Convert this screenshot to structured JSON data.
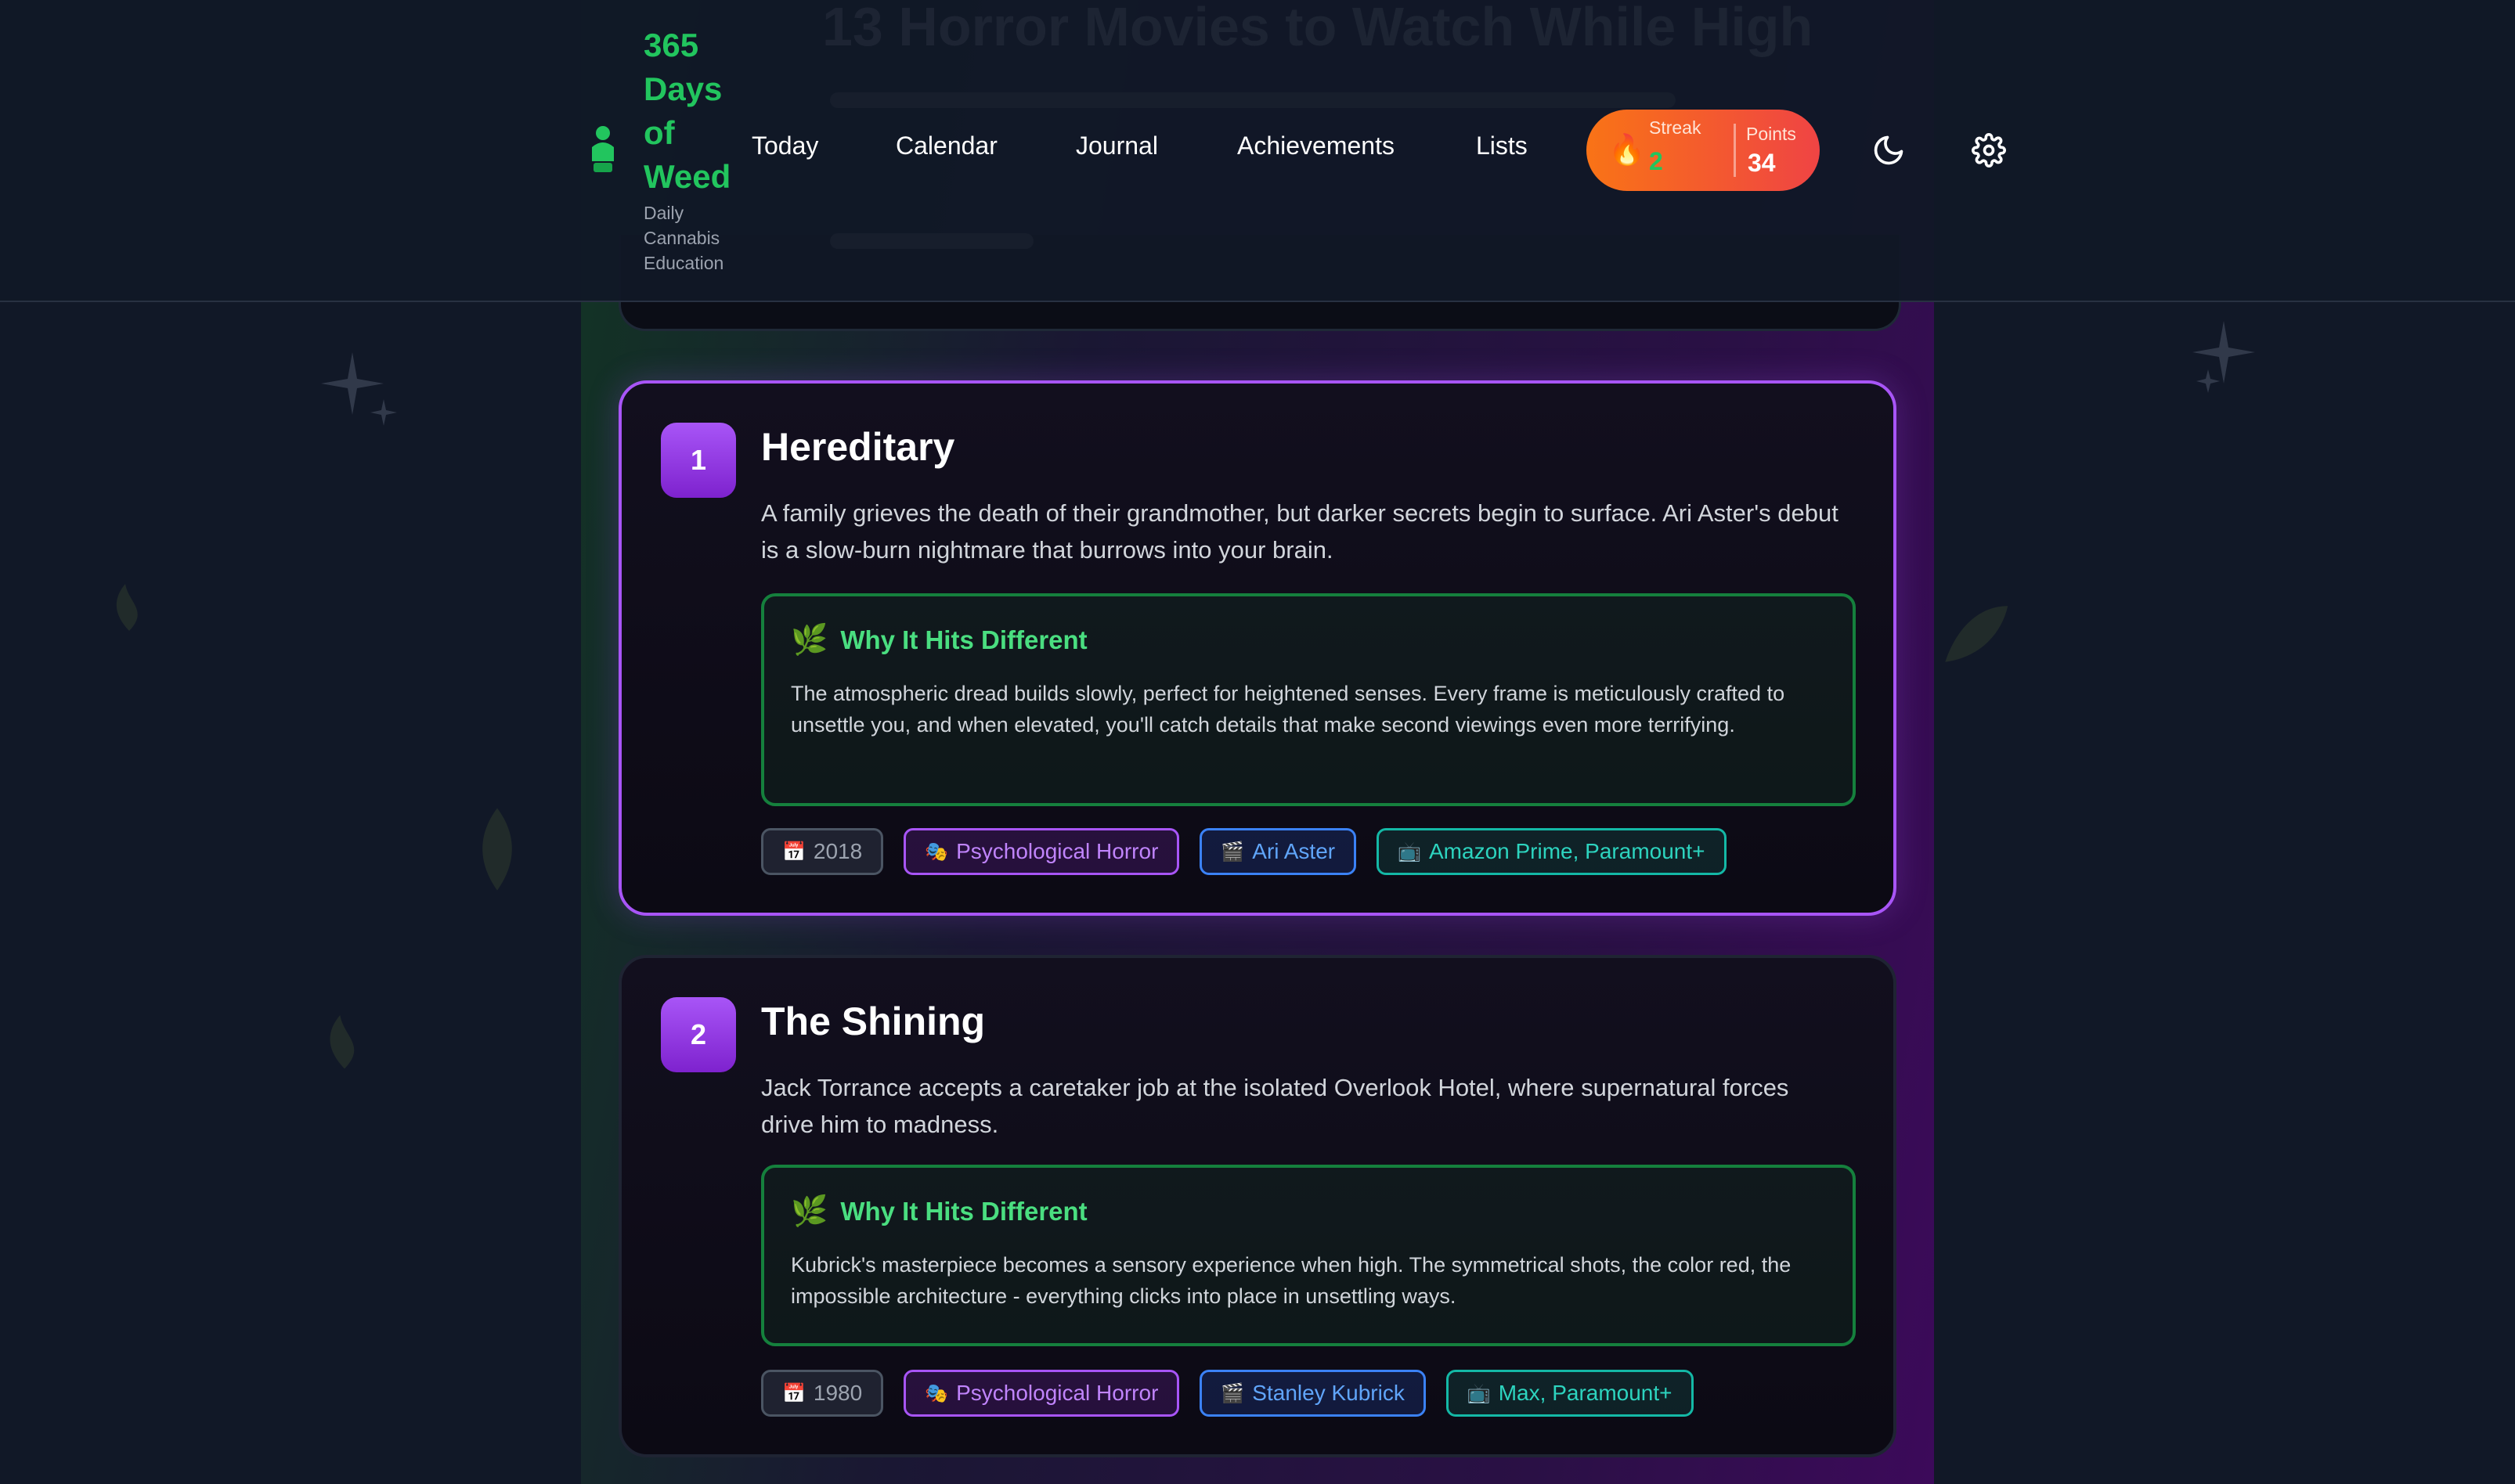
{
  "app": {
    "brand": "365 Days of Weed",
    "tagline": "Daily Cannabis Education",
    "ghost_title": "13 Horror Movies to Watch While High"
  },
  "nav": {
    "items": [
      "Today",
      "Calendar",
      "Journal",
      "Achievements",
      "Lists"
    ]
  },
  "stats": {
    "streak_label": "Streak",
    "streak_value": "2",
    "points_label": "Points",
    "points_value": "34"
  },
  "header_icons": [
    "moon-icon",
    "gear-icon"
  ],
  "movies": [
    {
      "rank": "1",
      "title": "Hereditary",
      "description": "A family grieves the death of their grandmother, but darker secrets begin to surface. Ari Aster's debut is a slow-burn nightmare that burrows into your brain.",
      "why_title": "Why It Hits Different",
      "why_text": "The atmospheric dread builds slowly, perfect for heightened senses. Every frame is meticulously crafted to unsettle you, and when elevated, you'll catch details that make second viewings even more terrifying.",
      "year": "2018",
      "genre": "Psychological Horror",
      "director": "Ari Aster",
      "streaming": "Amazon Prime, Paramount+"
    },
    {
      "rank": "2",
      "title": "The Shining",
      "description": "Jack Torrance accepts a caretaker job at the isolated Overlook Hotel, where supernatural forces drive him to madness.",
      "why_title": "Why It Hits Different",
      "why_text": "Kubrick's masterpiece becomes a sensory experience when high. The symmetrical shots, the color red, the impossible architecture - everything clicks into place in unsettling ways.",
      "year": "1980",
      "genre": "Psychological Horror",
      "director": "Stanley Kubrick",
      "streaming": "Max, Paramount+"
    }
  ],
  "tag_icons": {
    "year": "📅",
    "genre": "🎭",
    "director": "🎬",
    "streaming": "📺",
    "why": "🌿",
    "streak": "🔥"
  },
  "colors": {
    "accent_purple": "#a855f7",
    "accent_green": "#22c55e",
    "streak_orange": "#f97316",
    "background": "#111827"
  }
}
